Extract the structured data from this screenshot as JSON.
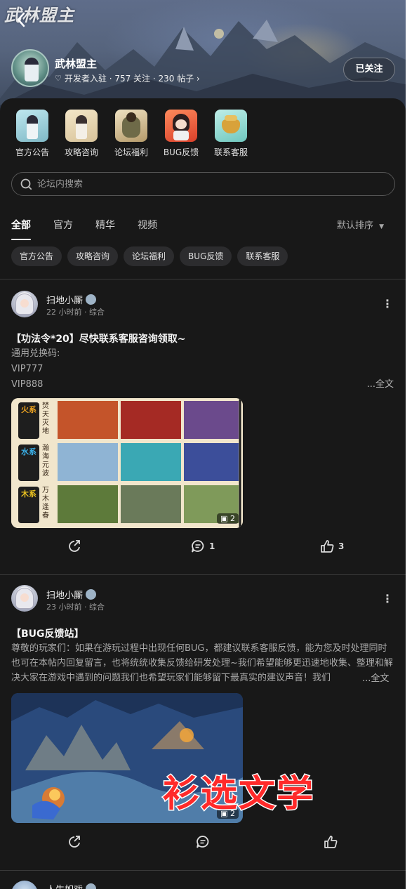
{
  "header": {
    "logo_text": "武林盟主",
    "back_icon": "chevron-left-icon",
    "forum_name": "武林盟主",
    "meta": "开发者入驻 · 757 关注 · 230 帖子 ›",
    "follow_label": "已关注"
  },
  "quick_links": [
    {
      "label": "官方公告",
      "icon": "announcement-icon"
    },
    {
      "label": "攻略咨询",
      "icon": "guide-icon"
    },
    {
      "label": "论坛福利",
      "icon": "welfare-icon"
    },
    {
      "label": "BUG反馈",
      "icon": "bug-feedback-icon"
    },
    {
      "label": "联系客服",
      "icon": "customer-service-icon"
    }
  ],
  "search": {
    "placeholder": "论坛内搜索"
  },
  "tabs": [
    "全部",
    "官方",
    "精华",
    "视频"
  ],
  "active_tab": "全部",
  "sort_label": "默认排序",
  "chips": [
    "官方公告",
    "攻略咨询",
    "论坛福利",
    "BUG反馈",
    "联系客服"
  ],
  "posts": [
    {
      "author": "扫地小厮",
      "time": "22 小时前 · 综合",
      "title": "【功法令*20】尽快联系客服咨询领取~",
      "body_lines": [
        "通用兑换码:",
        "VIP777",
        "VIP888"
      ],
      "more_label": "...全文",
      "image_count": "2",
      "image_row_labels": [
        "火系",
        "水系",
        "木系"
      ],
      "image_row_captions": [
        "焚天灭地",
        "瀚海元波",
        "万木逢春"
      ],
      "comments": "1",
      "likes": "3"
    },
    {
      "author": "扫地小厮",
      "time": "23 小时前 · 综合",
      "title": "【BUG反馈站】",
      "body": "尊敬的玩家们：如果在游玩过程中出现任何BUG，都建议联系客服反馈，能为您及时处理同时也可在本帖内回复留言，也将统统收集反馈给研发处理~我们希望能够更迅速地收集、整理和解决大家在游戏中遇到的问题我们也希望玩家们能够留下最真实的建议声音！我们",
      "more_label": "...全文",
      "image_count": "2",
      "comments": "",
      "likes": ""
    },
    {
      "author": "人生如戏"
    }
  ],
  "watermark": "衫选文学",
  "colors": {
    "background": "#181818",
    "chip": "#2c2c2e",
    "watermark": "#ff2a2a"
  }
}
